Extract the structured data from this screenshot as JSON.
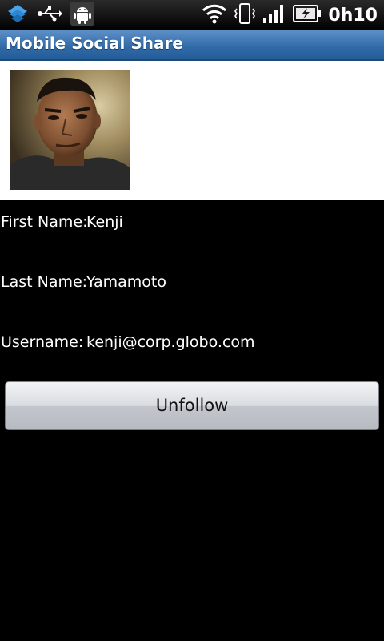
{
  "status_bar": {
    "time": "0h10",
    "left_icons": [
      "dropbox-icon",
      "usb-icon",
      "android-debug-icon"
    ],
    "right_icons": [
      "wifi-icon",
      "vibrate-icon",
      "signal-icon",
      "battery-charging-icon"
    ]
  },
  "app": {
    "title": "Mobile Social Share"
  },
  "profile": {
    "avatar_alt": "profile-photo",
    "fields": [
      {
        "label": "First Name:",
        "value": "Kenji"
      },
      {
        "label": "Last Name:",
        "value": "Yamamoto"
      },
      {
        "label": "Username:",
        "value": "kenji@corp.globo.com"
      }
    ]
  },
  "actions": {
    "unfollow_label": "Unfollow"
  },
  "colors": {
    "titlebar": "#2f6aa8",
    "background": "#000000",
    "photo_background": "#ffffff"
  }
}
